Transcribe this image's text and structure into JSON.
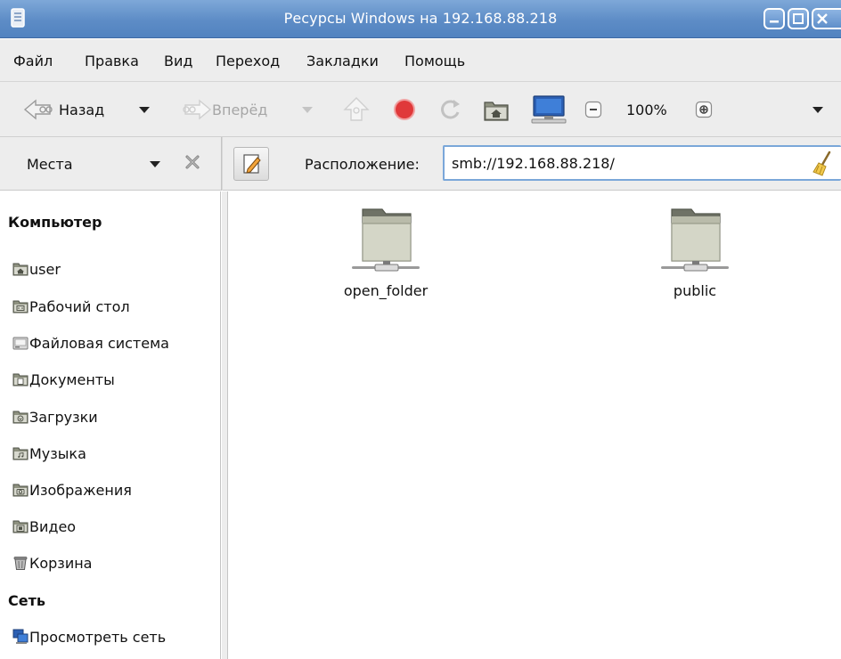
{
  "window": {
    "title": "Ресурсы Windows на 192.168.88.218"
  },
  "menu": {
    "items": [
      "Файл",
      "Правка",
      "Вид",
      "Переход",
      "Закладки",
      "Помощь"
    ]
  },
  "toolbar": {
    "back_label": "Назад",
    "forward_label": "Вперёд",
    "zoom_value": "100%"
  },
  "location": {
    "places_label": "Места",
    "location_label": "Расположение:",
    "value": "smb://192.168.88.218/"
  },
  "sidebar": {
    "computer_heading": "Компьютер",
    "computer_items": [
      {
        "label": "user",
        "icon": "home-folder-icon"
      },
      {
        "label": "Рабочий стол",
        "icon": "desktop-folder-icon"
      },
      {
        "label": "Файловая система",
        "icon": "filesystem-icon"
      },
      {
        "label": "Документы",
        "icon": "documents-folder-icon"
      },
      {
        "label": "Загрузки",
        "icon": "downloads-folder-icon"
      },
      {
        "label": "Музыка",
        "icon": "music-folder-icon"
      },
      {
        "label": "Изображения",
        "icon": "pictures-folder-icon"
      },
      {
        "label": "Видео",
        "icon": "videos-folder-icon"
      },
      {
        "label": "Корзина",
        "icon": "trash-icon"
      }
    ],
    "network_heading": "Сеть",
    "network_items": [
      {
        "label": "Просмотреть сеть",
        "icon": "network-icon"
      }
    ]
  },
  "content": {
    "shares": [
      {
        "name": "open_folder",
        "icon": "network-share-folder-icon"
      },
      {
        "name": "public",
        "icon": "network-share-folder-icon"
      }
    ]
  },
  "colors": {
    "titlebar": "#5d8cc6",
    "chrome": "#ededed",
    "input_border": "#7aa7d9",
    "stop_red": "#e0393a"
  }
}
